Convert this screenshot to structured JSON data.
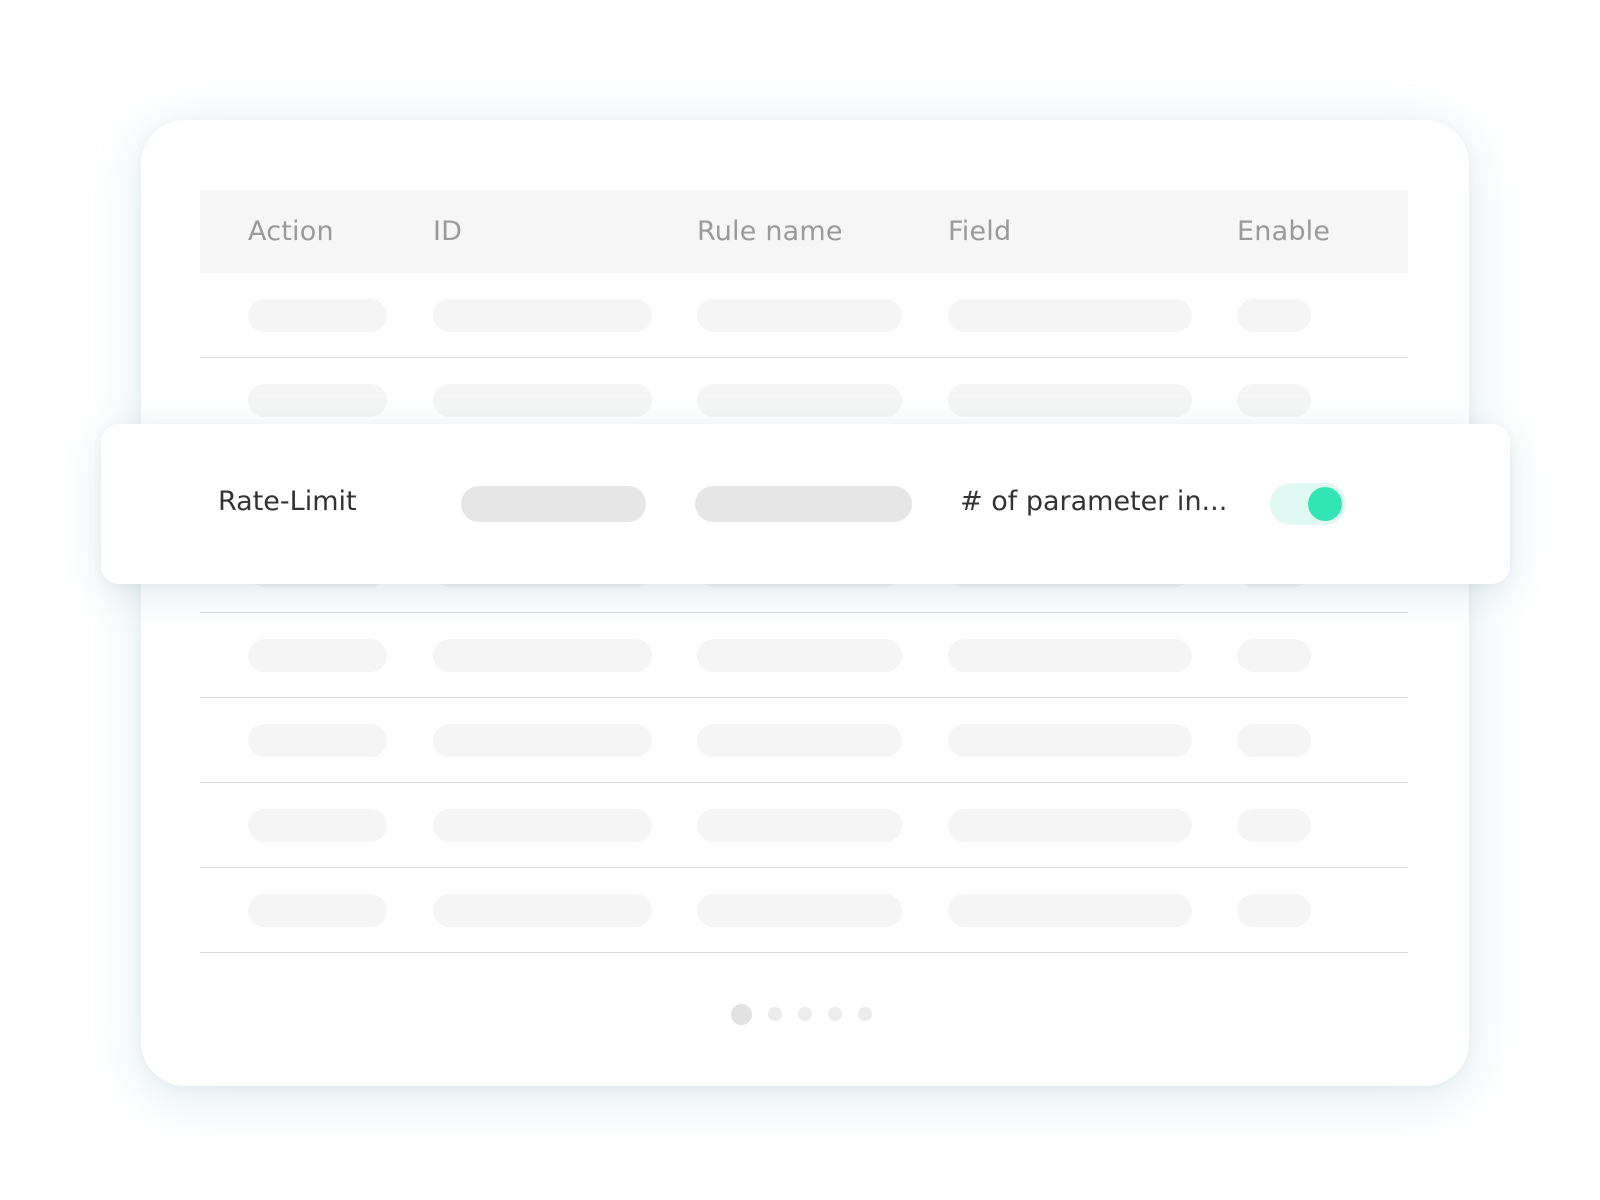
{
  "table": {
    "headers": {
      "action": "Action",
      "id": "ID",
      "rule_name": "Rule name",
      "field": "Field",
      "enable": "Enable"
    }
  },
  "highlighted_row": {
    "action": "Rate-Limit",
    "field": "# of parameter in...",
    "enabled": true
  },
  "colors": {
    "toggle_on": "#31e6b4",
    "toggle_track": "#dff9f2"
  },
  "pagination": {
    "page_count": 5,
    "current_page": 1
  }
}
